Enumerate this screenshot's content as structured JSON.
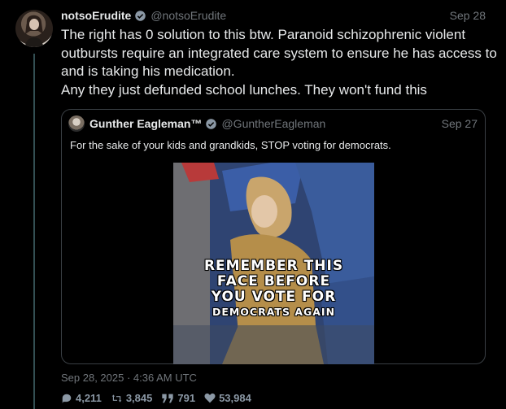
{
  "post": {
    "display_name": "notsoErudite",
    "handle": "@notsoErudite",
    "date": "Sep 28",
    "text_lines": [
      "The right has 0 solution to this btw. Paranoid schizophrenic violent outbursts require an integrated care system to ensure he has access to and is taking his medication.",
      "Any they just defunded school lunches. They won't fund this"
    ],
    "timestamp": "Sep 28, 2025 · 4:36 AM UTC",
    "stats": {
      "replies": "4,211",
      "retweets": "3,845",
      "quotes": "791",
      "likes": "53,984"
    }
  },
  "quote": {
    "display_name": "Gunther Eagleman™",
    "handle": "@GuntherEagleman",
    "date": "Sep 27",
    "text": "For the sake of your kids and grandkids, STOP voting for democrats.",
    "media_caption": [
      "REMEMBER THIS",
      "FACE BEFORE",
      "YOU VOTE FOR",
      "DEMOCRATS AGAIN"
    ]
  },
  "colors": {
    "background": "#000000",
    "text": "#e7e9ea",
    "muted": "#71767b",
    "verified": "#1d9bf0",
    "border": "#3a3f44"
  },
  "icons": [
    "verified-badge-icon",
    "reply-icon",
    "retweet-icon",
    "quote-icon",
    "like-icon"
  ]
}
